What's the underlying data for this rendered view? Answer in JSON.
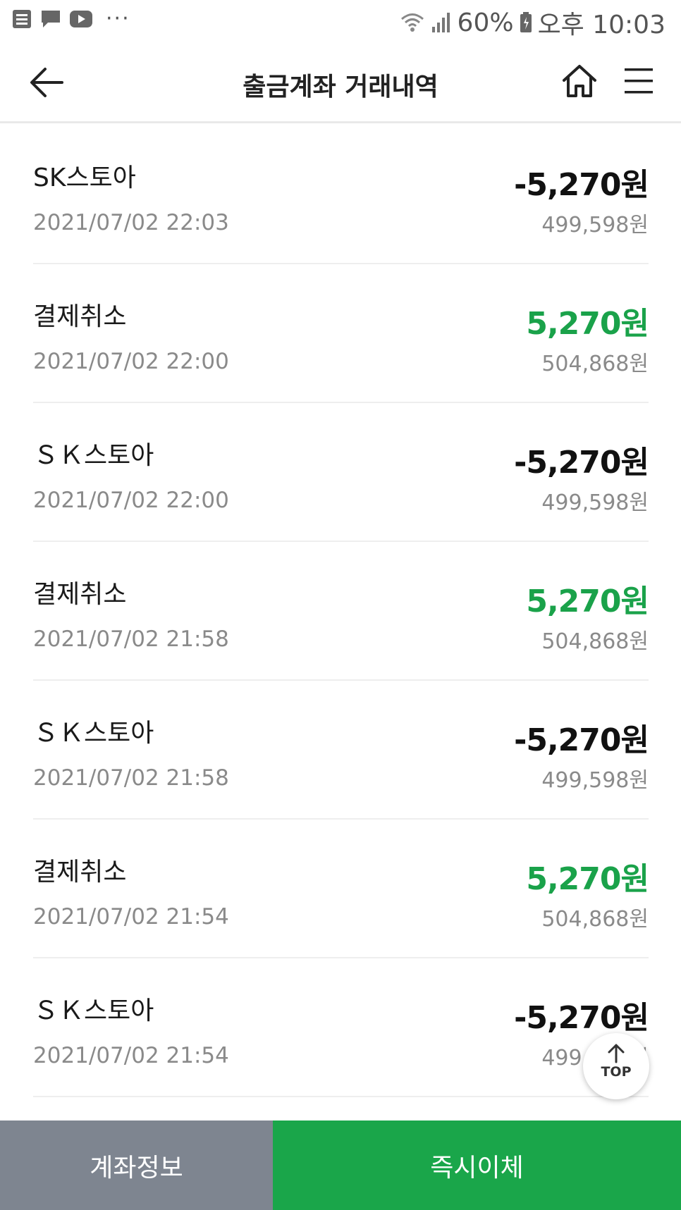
{
  "status_bar": {
    "dots": "···",
    "battery": "60%",
    "time": "오후 10:03"
  },
  "header": {
    "title": "출금계좌 거래내역"
  },
  "transactions": [
    {
      "name": "SK스토아",
      "datetime": "2021/07/02  22:03",
      "amount": "-5,270원",
      "balance": "499,598원",
      "color": "#111111"
    },
    {
      "name": "결제취소",
      "datetime": "2021/07/02  22:00",
      "amount": "5,270원",
      "balance": "504,868원",
      "color": "#1aa24a"
    },
    {
      "name": "ＳＫ스토아",
      "datetime": "2021/07/02  22:00",
      "amount": "-5,270원",
      "balance": "499,598원",
      "color": "#111111"
    },
    {
      "name": "결제취소",
      "datetime": "2021/07/02  21:58",
      "amount": "5,270원",
      "balance": "504,868원",
      "color": "#1aa24a"
    },
    {
      "name": "ＳＫ스토아",
      "datetime": "2021/07/02  21:58",
      "amount": "-5,270원",
      "balance": "499,598원",
      "color": "#111111"
    },
    {
      "name": "결제취소",
      "datetime": "2021/07/02  21:54",
      "amount": "5,270원",
      "balance": "504,868원",
      "color": "#1aa24a"
    },
    {
      "name": "ＳＫ스토아",
      "datetime": "2021/07/02  21:54",
      "amount": "-5,270원",
      "balance": "499,598원",
      "color": "#111111"
    }
  ],
  "top_button": {
    "label": "TOP"
  },
  "bottom_bar": {
    "account_info": "계좌정보",
    "instant_transfer": "즉시이체"
  },
  "colors": {
    "accent_green": "#1aa64a",
    "gray_button": "#7e8590"
  }
}
